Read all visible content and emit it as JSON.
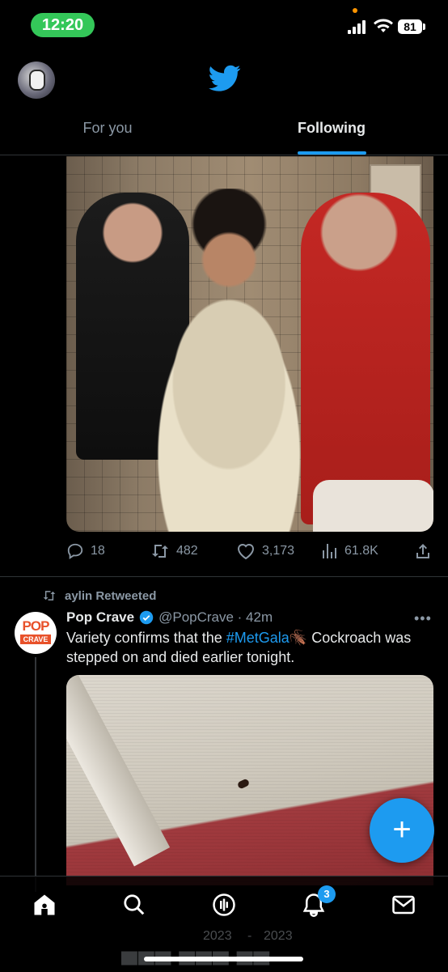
{
  "status_bar": {
    "time": "12:20",
    "battery": "81"
  },
  "header": {
    "tabs": [
      {
        "label": "For you",
        "active": false
      },
      {
        "label": "Following",
        "active": true
      }
    ],
    "accent_color": "#1d9bf0"
  },
  "tweet1": {
    "actions": {
      "replies": "18",
      "retweets": "482",
      "likes": "3,173",
      "views": "61.8K"
    }
  },
  "tweet2": {
    "retweeted_by": "aylin Retweeted",
    "avatar": {
      "line1": "POP",
      "line2": "CRAVE"
    },
    "author_name": "Pop Crave",
    "handle_time": "@PopCrave · 42m",
    "text_before": "Variety confirms that the ",
    "hashtag": "#MetGala",
    "emoji": "🪳",
    "text_after": " Cockroach was stepped on and died earlier tonight."
  },
  "fab_label": "+",
  "tabbar": {
    "notifications_badge": "3"
  },
  "bleed_through": {
    "year_left": "2023",
    "separator": "-",
    "year_right": "2023"
  }
}
